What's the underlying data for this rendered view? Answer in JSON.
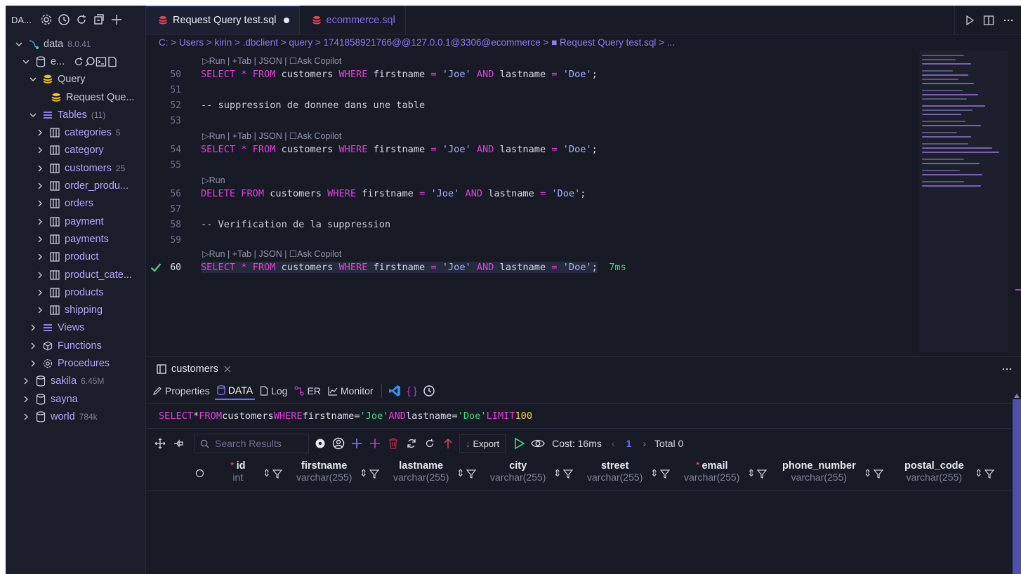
{
  "sidebar": {
    "title": "DA...",
    "tree": [
      {
        "label": "data",
        "meta": "8.0.41"
      },
      {
        "label": "e..."
      },
      {
        "label": "Query"
      },
      {
        "label": "Request Que..."
      },
      {
        "label": "Tables",
        "meta": "(11)"
      },
      {
        "label": "categories",
        "meta": "5"
      },
      {
        "label": "category"
      },
      {
        "label": "customers",
        "meta": "25"
      },
      {
        "label": "order_produ..."
      },
      {
        "label": "orders"
      },
      {
        "label": "payment"
      },
      {
        "label": "payments"
      },
      {
        "label": "product"
      },
      {
        "label": "product_cate..."
      },
      {
        "label": "products"
      },
      {
        "label": "shipping"
      },
      {
        "label": "Views"
      },
      {
        "label": "Functions"
      },
      {
        "label": "Procedures"
      },
      {
        "label": "sakila",
        "meta": "6.45M"
      },
      {
        "label": "sayna"
      },
      {
        "label": "world",
        "meta": "784k"
      }
    ]
  },
  "tabs": [
    {
      "label": "Request Query test.sql",
      "active": true,
      "modified": true
    },
    {
      "label": "ecommerce.sql",
      "active": false
    }
  ],
  "breadcrumb": "C: > Users > kirin > .dbclient > query > 1741858921766@@127.0.0.1@3306@ecommerce > ■ Request Query test.sql > ...",
  "codelens": {
    "full": "▷Run | +Tab | JSON | ☐Ask Copilot",
    "run_only": "▷Run"
  },
  "code": {
    "line_numbers": [
      "50",
      "51",
      "52",
      "53",
      "54",
      "55",
      "56",
      "57",
      "58",
      "59",
      "60"
    ],
    "comment_delete": "-- suppression de donnee dans une table",
    "comment_verify": "-- Verification de la suppression",
    "select_kw": "SELECT",
    "star": "*",
    "from_kw": "FROM",
    "table": "customers",
    "where_kw": "WHERE",
    "col1": "firstname",
    "eq": "=",
    "val1": "'Joe'",
    "and_kw": "AND",
    "col2": "lastname",
    "val2": "'Doe'",
    "semi": ";",
    "delete_kw": "DELETE",
    "exec_time": "7ms"
  },
  "panel": {
    "tab_label": "customers",
    "subtabs": [
      "Properties",
      "DATA",
      "Log",
      "ER",
      "Monitor"
    ],
    "sql": {
      "select": "SELECT",
      "star": "*",
      "from": "FROM",
      "table": "customers",
      "where": "WHERE",
      "c1": "firstname",
      "eq": "=",
      "v1": "'Joe'",
      "and": "AND",
      "c2": "lastname",
      "v2": "'Doe'",
      "limit": "LIMIT",
      "limit_val": "100"
    },
    "search_placeholder": "Search Results",
    "export_label": "Export",
    "cost": "Cost: 16ms",
    "page": "1",
    "total": "Total 0",
    "columns": [
      {
        "name": "id",
        "type": "int",
        "required": true
      },
      {
        "name": "firstname",
        "type": "varchar(255)",
        "required": false
      },
      {
        "name": "lastname",
        "type": "varchar(255)",
        "required": false
      },
      {
        "name": "city",
        "type": "varchar(255)",
        "required": false
      },
      {
        "name": "street",
        "type": "varchar(255)",
        "required": false
      },
      {
        "name": "email",
        "type": "varchar(255)",
        "required": true
      },
      {
        "name": "phone_number",
        "type": "varchar(255)",
        "required": false
      },
      {
        "name": "postal_code",
        "type": "varchar(255)",
        "required": false
      }
    ]
  },
  "colors": {
    "keyword": "#e040d8",
    "string": "#a8b4ff",
    "success": "#42d77d",
    "accent": "#6a70ff",
    "number": "#f0d24a"
  }
}
